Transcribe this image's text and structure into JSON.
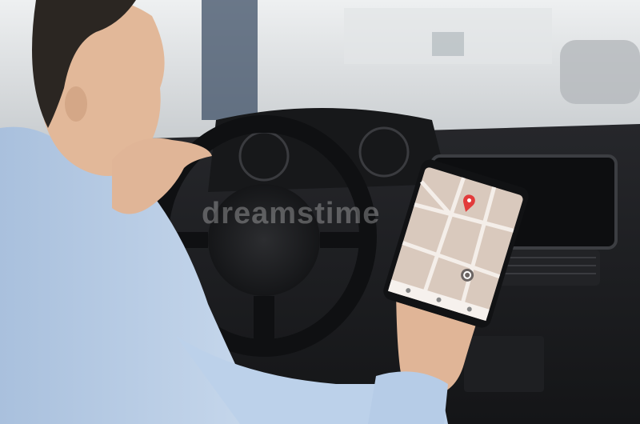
{
  "scene": {
    "watermark": "dreamstime",
    "colors": {
      "shirt": "#b8cde6",
      "dashboard": "#1c1d20",
      "windshield": "#d9dde0",
      "map_bg": "#d9c9bd",
      "map_road": "#f4eee9",
      "pin": "#e23b3b"
    },
    "icons": [
      "location-pin-icon",
      "navigation-target-icon",
      "home-icon",
      "search-icon",
      "user-icon"
    ]
  }
}
